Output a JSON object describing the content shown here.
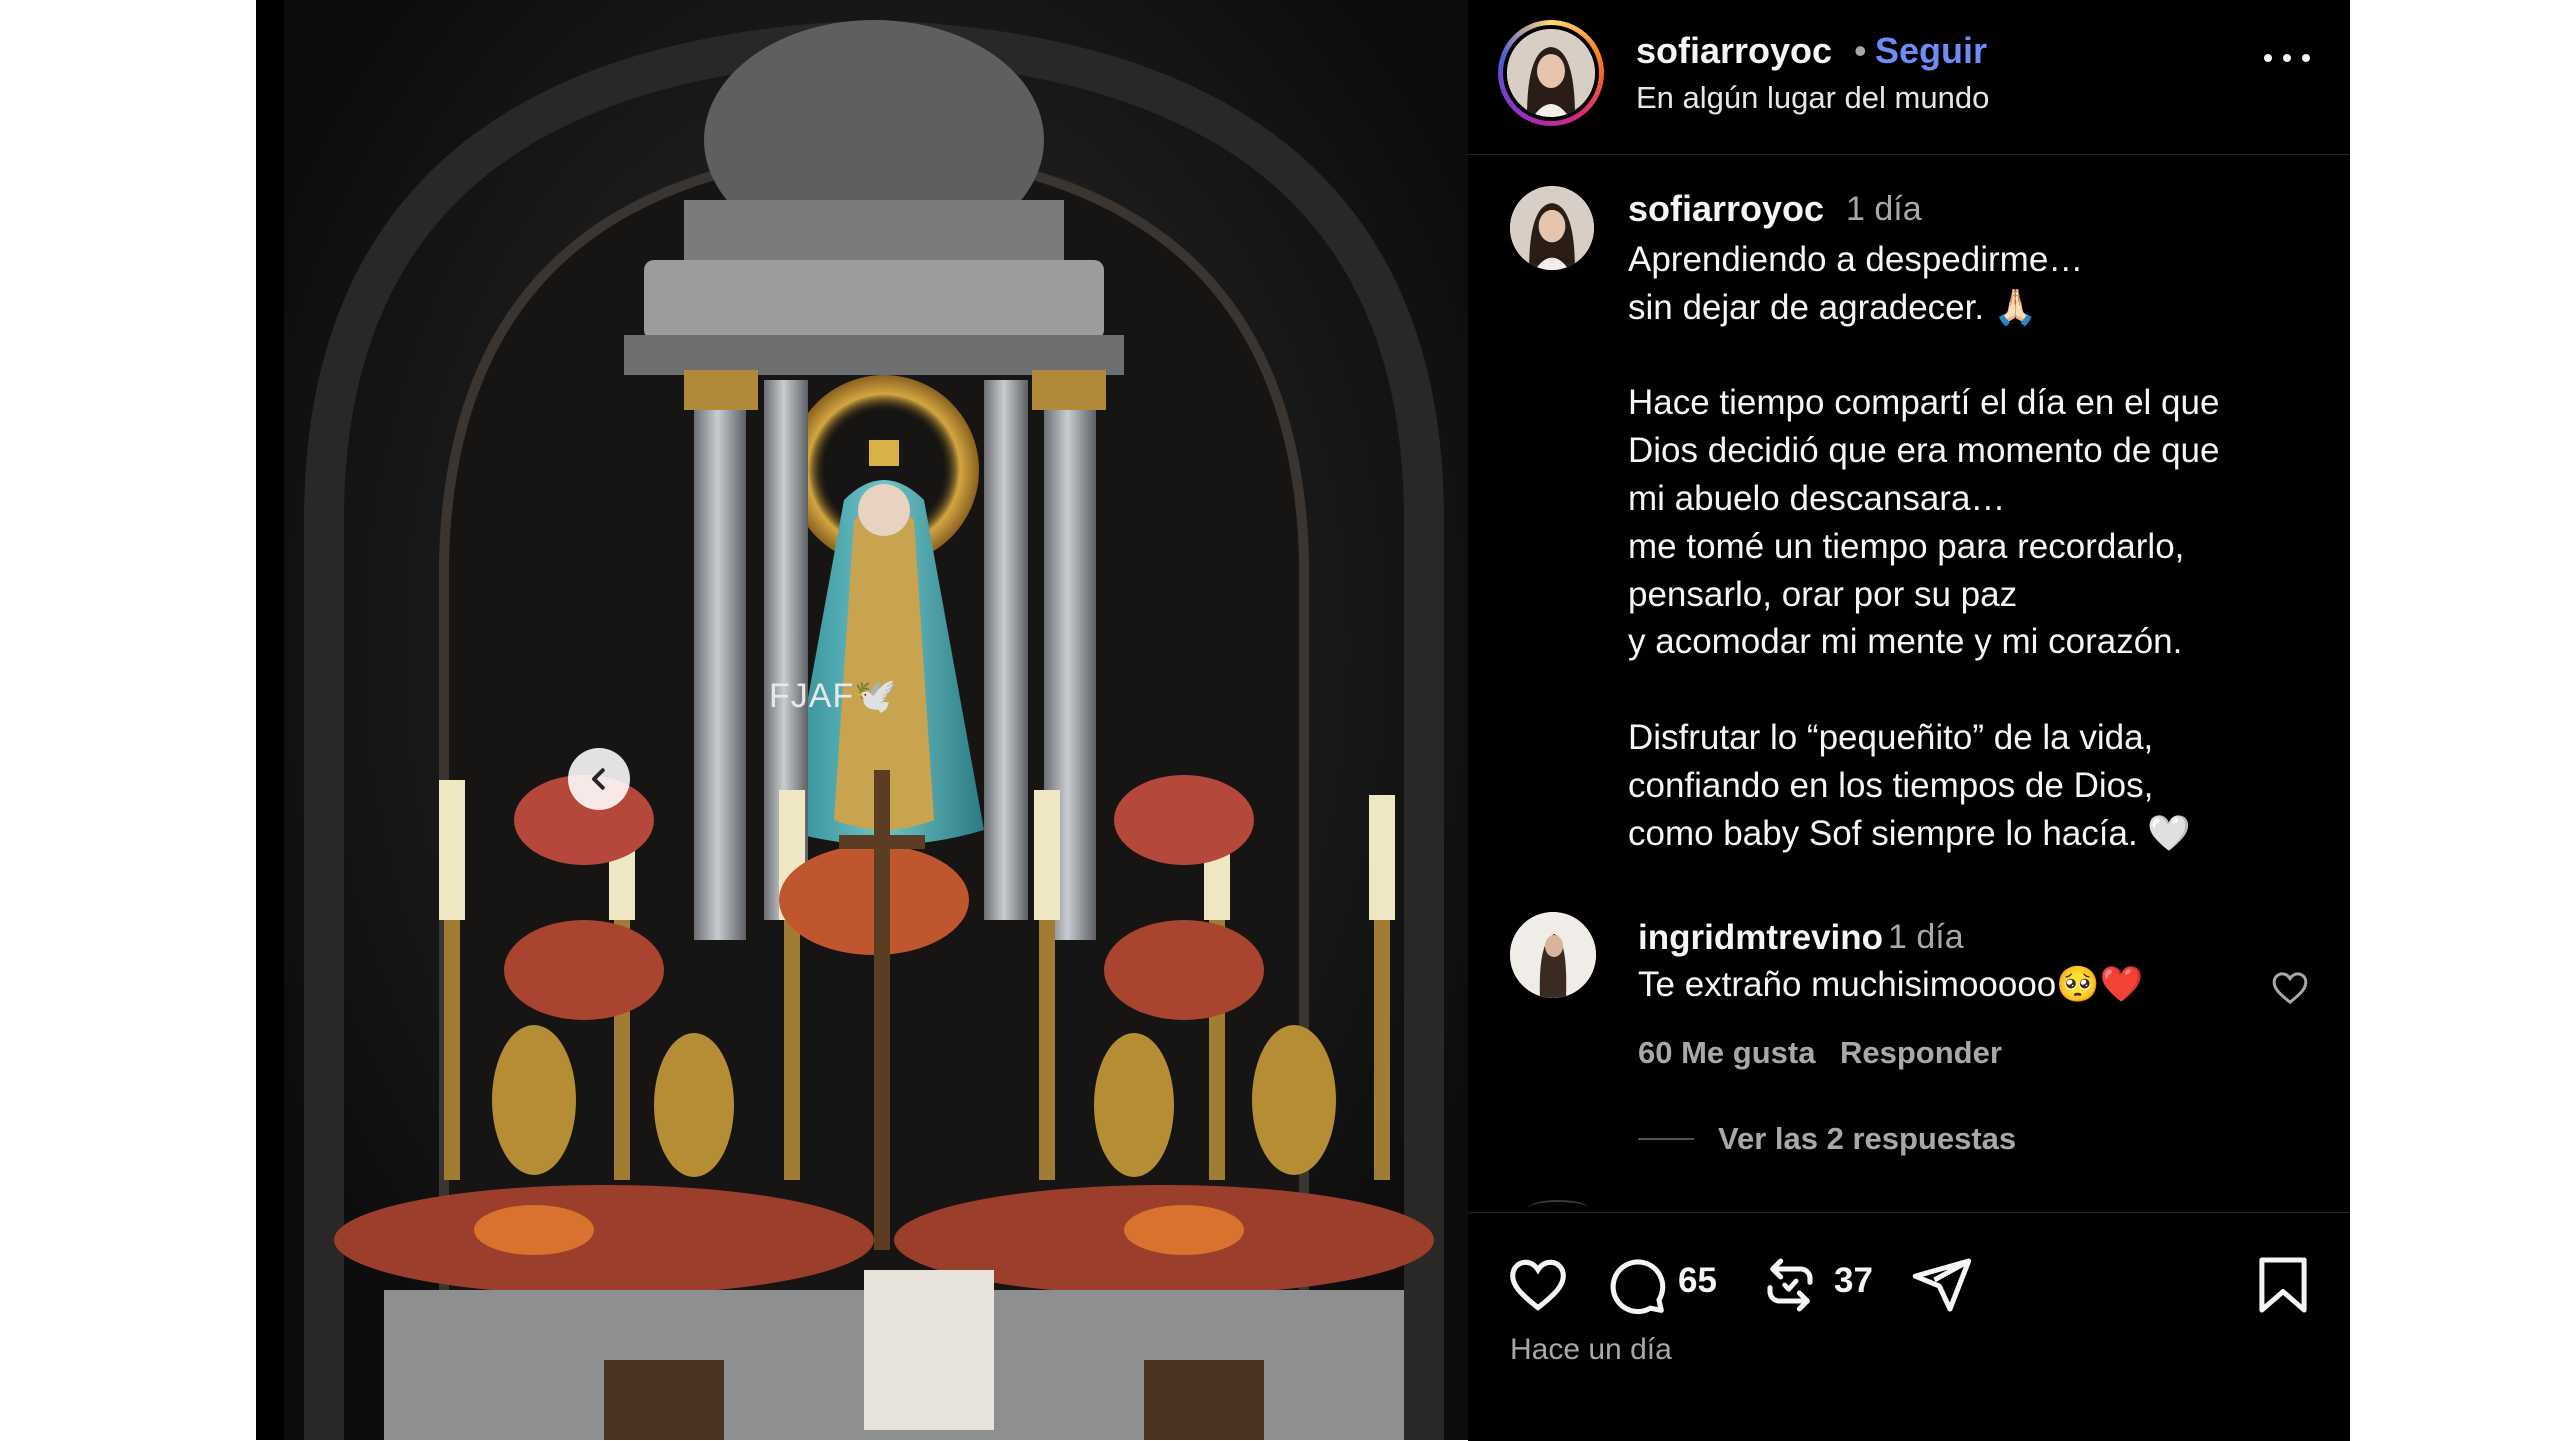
{
  "media": {
    "watermark": "FJAF🕊️",
    "nav_prev_icon": "chevron-left-icon"
  },
  "header": {
    "username": "sofiarroyoc",
    "separator": "•",
    "follow_label": "Seguir",
    "location": "En algún lugar del mundo",
    "more_icon": "more-horizontal-icon"
  },
  "caption": {
    "username": "sofiarroyoc",
    "time": "1 día",
    "lines": [
      "Aprendiendo a despedirme…",
      "sin dejar de agradecer. 🙏🏻",
      "",
      "Hace tiempo compartí el día en el que",
      "Dios decidió que era momento de que",
      "mi abuelo descansara…",
      "me tomé un tiempo para recordarlo,",
      "pensarlo, orar por su paz",
      "y acomodar mi mente y mi corazón.",
      "",
      "Disfrutar lo “pequeñito” de la vida,",
      "confiando en los tiempos de Dios,",
      "como baby Sof siempre lo hacía. 🤍"
    ]
  },
  "comment": {
    "username": "ingridmtrevino",
    "time": "1 día",
    "text": "Te extraño muchisimooooo🥺❤️",
    "likes": "60 Me gusta",
    "reply_label": "Responder",
    "view_replies": "Ver las 2 respuestas"
  },
  "actions": {
    "comments_count": "65",
    "reposts_count": "37",
    "timestamp": "Hace un día"
  },
  "colors": {
    "background": "#000000",
    "follow": "#6f8bf5",
    "muted": "#a8a8a8"
  }
}
